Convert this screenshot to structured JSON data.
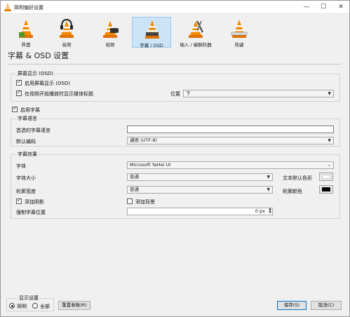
{
  "window": {
    "title": "简明偏好设置",
    "minimize": "—",
    "maximize": "☐",
    "close": "✕"
  },
  "toolbar": [
    {
      "label": "界面",
      "icon": "cone-interface-icon"
    },
    {
      "label": "音频",
      "icon": "cone-headphones-icon"
    },
    {
      "label": "视频",
      "icon": "cone-video-icon"
    },
    {
      "label": "字幕 / OSD",
      "icon": "cone-subtitles-icon",
      "selected": true
    },
    {
      "label": "输入 / 编解码器",
      "icon": "cone-codec-icon"
    },
    {
      "label": "热键",
      "icon": "cone-hotkeys-icon"
    }
  ],
  "header": {
    "title": "字幕 & OSD 设置"
  },
  "osd": {
    "group_title": "屏幕显示 (OSD)",
    "enable_osd_label": "启用屏幕显示 (OSD)",
    "enable_osd_checked": true,
    "show_title_label": "在视频开始播放时显示媒体标题",
    "show_title_checked": true,
    "position_label": "位置",
    "position_value": "下"
  },
  "subtitles": {
    "enable_label": "启用字幕",
    "enable_checked": true,
    "language_group": "字幕语言",
    "preferred_lang_label": "首选的字幕语言",
    "preferred_lang_value": "",
    "encoding_label": "默认编码",
    "encoding_value": "通用 (UTF-8)"
  },
  "effects": {
    "group_title": "字幕效果",
    "font_label": "字体",
    "font_value": "Microsoft YaHei UI",
    "size_label": "字体大小",
    "size_value": "普通",
    "text_color_label": "文本默认色彩",
    "outline_label": "轮廓宽度",
    "outline_value": "普通",
    "outline_color_label": "轮廓颜色",
    "shadow_label": "添加阴影",
    "shadow_checked": true,
    "background_label": "添加背景",
    "background_checked": false,
    "force_pos_label": "强制字幕位置",
    "force_pos_value": "0 px"
  },
  "footer": {
    "show_settings_title": "显示设置",
    "simple_label": "简明",
    "all_label": "全部",
    "reset_label": "重置参数(R)",
    "save_label": "保存(S)",
    "cancel_label": "取消(C)"
  },
  "colors": {
    "text_default": "#ffffff",
    "outline": "#000000",
    "selected_tab": "#cce4f7",
    "accent": "#0078d7"
  }
}
